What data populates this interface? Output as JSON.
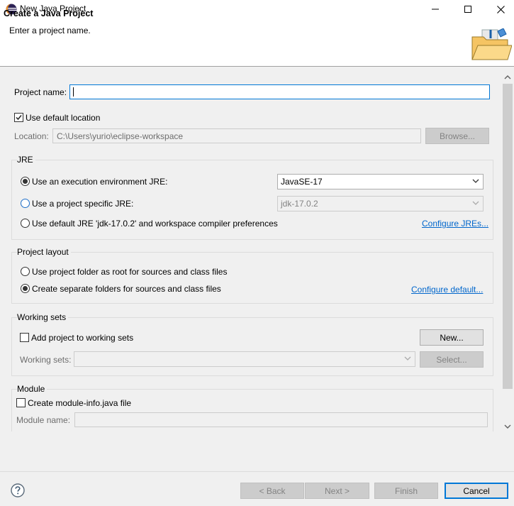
{
  "window": {
    "title": "New Java Project",
    "icons": [
      "eclipse-icon",
      "minimize-icon",
      "maximize-icon",
      "close-icon"
    ]
  },
  "header": {
    "title": "Create a Java Project",
    "message": "Enter a project name.",
    "image_icon": "folder-wizard-icon"
  },
  "project": {
    "name_label": "Project name:",
    "name_value": "",
    "use_default_location_label": "Use default location",
    "use_default_location_checked": true,
    "location_label": "Location:",
    "location_value": "C:\\Users\\yurio\\eclipse-workspace",
    "browse_label": "Browse..."
  },
  "jre": {
    "group_title": "JRE",
    "option_env_label": "Use an execution environment JRE:",
    "option_env_value": "JavaSE-17",
    "option_specific_label": "Use a project specific JRE:",
    "option_specific_value": "jdk-17.0.2",
    "option_default_label": "Use default JRE 'jdk-17.0.2' and workspace compiler preferences",
    "configure_link": "Configure JREs...",
    "selected": "env"
  },
  "layout": {
    "group_title": "Project layout",
    "option_root_label": "Use project folder as root for sources and class files",
    "option_separate_label": "Create separate folders for sources and class files",
    "configure_link": "Configure default...",
    "selected": "separate"
  },
  "working_sets": {
    "group_title": "Working sets",
    "add_label": "Add project to working sets",
    "add_checked": false,
    "new_label": "New...",
    "sets_label": "Working sets:",
    "select_label": "Select..."
  },
  "module": {
    "group_title": "Module",
    "create_label": "Create module-info.java file",
    "create_checked": false,
    "name_label": "Module name:"
  },
  "footer": {
    "help_icon": "help-icon",
    "back_label": "< Back",
    "next_label": "Next >",
    "finish_label": "Finish",
    "cancel_label": "Cancel"
  },
  "colors": {
    "accent": "#0078d7",
    "link": "#0066cc"
  }
}
